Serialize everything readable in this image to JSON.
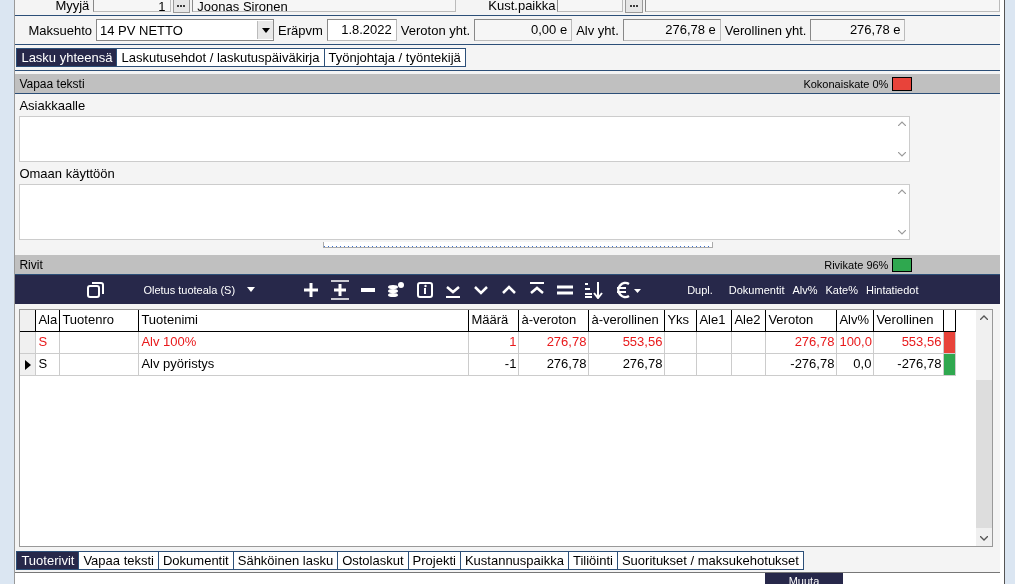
{
  "top_row": {
    "seller_label": "Myyjä",
    "seller_no": "1",
    "seller_name": "Joonas Sironen",
    "cost_center_label": "Kust.paikka"
  },
  "summary": {
    "terms_label": "Maksuehto",
    "terms_value": "14 PV NETTO",
    "due_label": "Eräpvm",
    "due_value": "1.8.2022",
    "totals": [
      {
        "label": "Veroton yht.",
        "value": "0,00 e"
      },
      {
        "label": "Alv yht.",
        "value": "276,78 e"
      },
      {
        "label": "Verollinen yht.",
        "value": "276,78 e"
      }
    ]
  },
  "tabs": [
    {
      "label": "Lasku yhteensä",
      "selected": true
    },
    {
      "label": "Laskutusehdot / laskutuspäiväkirja",
      "selected": false
    },
    {
      "label": "Työnjohtaja / työntekijä",
      "selected": false
    }
  ],
  "free_text": {
    "title": "Vapaa teksti",
    "margin_label": "Kokonaiskate 0%",
    "margin_ok": false,
    "fields": [
      {
        "label": "Asiakkaalle"
      },
      {
        "label": "Omaan käyttöön"
      }
    ]
  },
  "rows_section": {
    "title": "Rivit",
    "margin_label": "Rivikate 96%",
    "margin_ok": true,
    "toolbar": {
      "product_area": "Oletus tuoteala (S)",
      "text_buttons": [
        "Dupl.",
        "Dokumentit",
        "Alv%",
        "Kate%",
        "Hintatiedot"
      ]
    },
    "columns": [
      "Ala",
      "Tuotenro",
      "Tuotenimi",
      "Määrä",
      "à-veroton",
      "à-verollinen",
      "Yks",
      "Ale1",
      "Ale2",
      "Veroton",
      "Alv%",
      "Verollinen"
    ],
    "rows": [
      {
        "selected": false,
        "warning": true,
        "color": "#e8433a",
        "cells": [
          "S",
          "",
          "Alv 100%",
          "1",
          "276,78",
          "553,56",
          "",
          "",
          "",
          "276,78",
          "100,0",
          "553,56"
        ]
      },
      {
        "selected": true,
        "warning": false,
        "color": "#2fa84f",
        "cells": [
          "S",
          "",
          "Alv pyöristys",
          "-1",
          "276,78",
          "276,78",
          "",
          "",
          "",
          "-276,78",
          "0,0",
          "-276,78"
        ]
      }
    ]
  },
  "bottom_tabs": [
    {
      "label": "Tuoterivit",
      "selected": true
    },
    {
      "label": "Vapaa teksti",
      "selected": false
    },
    {
      "label": "Dokumentit",
      "selected": false
    },
    {
      "label": "Sähköinen lasku",
      "selected": false
    },
    {
      "label": "Ostolaskut",
      "selected": false
    },
    {
      "label": "Projekti",
      "selected": false
    },
    {
      "label": "Kustannuspaikka",
      "selected": false
    },
    {
      "label": "Tiliöinti",
      "selected": false
    },
    {
      "label": "Suoritukset / maksukehotukset",
      "selected": false
    }
  ],
  "action_button": "Muuta"
}
